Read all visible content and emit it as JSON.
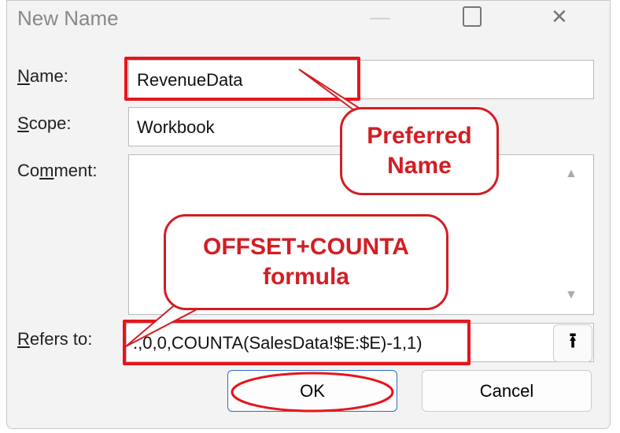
{
  "dialog": {
    "title": "New Name"
  },
  "labels": {
    "name_pre": "N",
    "name_rest": "ame:",
    "scope_pre": "S",
    "scope_rest": "cope:",
    "comment_pre": "Co",
    "comment_u": "m",
    "comment_rest": "ment:",
    "refers_pre": "R",
    "refers_rest": "efers to:"
  },
  "fields": {
    "name": "RevenueData",
    "scope": "Workbook",
    "comment": "",
    "refers_to": ":,0,0,COUNTA(SalesData!$E:$E)-1,1)"
  },
  "buttons": {
    "ok": "OK",
    "cancel": "Cancel"
  },
  "callouts": {
    "preferred_line1": "Preferred",
    "preferred_line2": "Name",
    "formula_line1": "OFFSET+COUNTA",
    "formula_line2": "formula"
  },
  "colors": {
    "highlight": "#e8141c"
  }
}
